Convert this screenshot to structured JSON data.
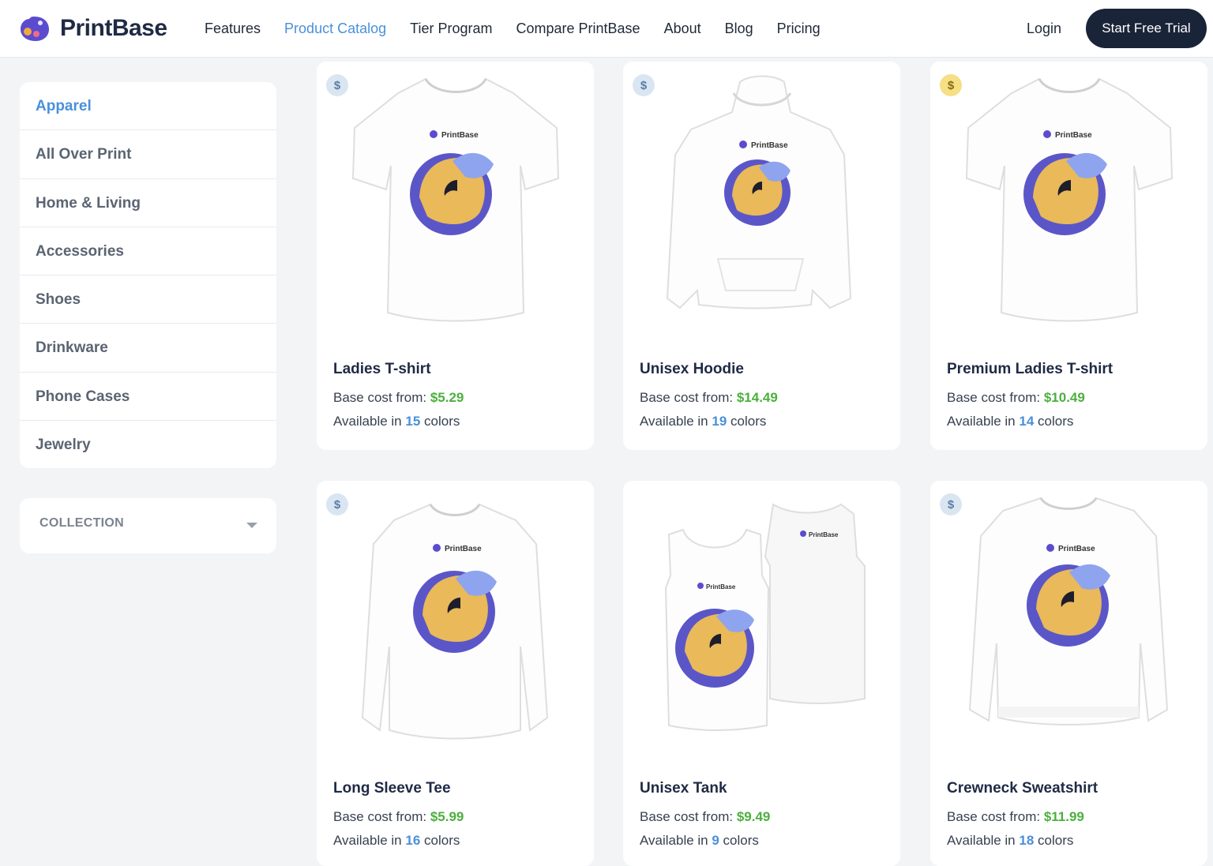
{
  "header": {
    "logo_text": "PrintBase",
    "nav": [
      "Features",
      "Product Catalog",
      "Tier Program",
      "Compare PrintBase",
      "About",
      "Blog",
      "Pricing"
    ],
    "active_nav": "Product Catalog",
    "login_label": "Login",
    "cta_label": "Start Free Trial"
  },
  "sidebar": {
    "categories": [
      "Apparel",
      "All Over Print",
      "Home & Living",
      "Accessories",
      "Shoes",
      "Drinkware",
      "Phone Cases",
      "Jewelry"
    ],
    "active_category": "Apparel",
    "collection_label": "COLLECTION"
  },
  "products": [
    {
      "name": "Ladies T-shirt",
      "base_label": "Base cost from: ",
      "price": "$5.29",
      "avail_prefix": "Available in ",
      "colors": "15",
      "avail_suffix": " colors",
      "badge": "$",
      "badge_color": "blue",
      "image": "tshirt-icon"
    },
    {
      "name": "Unisex Hoodie",
      "base_label": "Base cost from: ",
      "price": "$14.49",
      "avail_prefix": "Available in ",
      "colors": "19",
      "avail_suffix": " colors",
      "badge": "$",
      "badge_color": "blue",
      "image": "hoodie-icon"
    },
    {
      "name": "Premium Ladies T-shirt",
      "base_label": "Base cost from: ",
      "price": "$10.49",
      "avail_prefix": "Available in ",
      "colors": "14",
      "avail_suffix": " colors",
      "badge": "$",
      "badge_color": "gold",
      "image": "tshirt-icon"
    },
    {
      "name": "Long Sleeve Tee",
      "base_label": "Base cost from: ",
      "price": "$5.99",
      "avail_prefix": "Available in ",
      "colors": "16",
      "avail_suffix": " colors",
      "badge": "$",
      "badge_color": "blue",
      "image": "longsleeve-icon"
    },
    {
      "name": "Unisex Tank",
      "base_label": "Base cost from: ",
      "price": "$9.49",
      "avail_prefix": "Available in ",
      "colors": "9",
      "avail_suffix": " colors",
      "badge": "",
      "badge_color": "",
      "image": "tank-icon"
    },
    {
      "name": "Crewneck Sweatshirt",
      "base_label": "Base cost from: ",
      "price": "$11.99",
      "avail_prefix": "Available in ",
      "colors": "18",
      "avail_suffix": " colors",
      "badge": "$",
      "badge_color": "blue",
      "image": "sweatshirt-icon"
    }
  ],
  "garment_print_text": "PrintBase",
  "colors": {
    "accent": "#4a90d9",
    "price": "#4caf3e",
    "cta_bg": "#1a2438"
  }
}
